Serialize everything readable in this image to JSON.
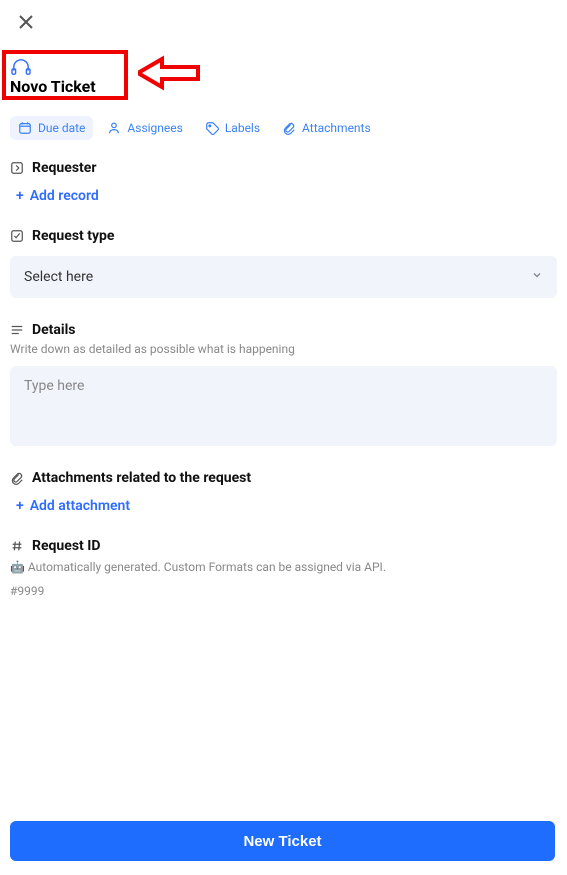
{
  "header": {
    "title": "Novo Ticket"
  },
  "pills": {
    "due_date": "Due date",
    "assignees": "Assignees",
    "labels": "Labels",
    "attachments": "Attachments"
  },
  "requester": {
    "label": "Requester",
    "add": "Add record"
  },
  "request_type": {
    "label": "Request type",
    "placeholder": "Select here"
  },
  "details": {
    "label": "Details",
    "hint": "Write down as detailed as possible what is happening",
    "placeholder": "Type here"
  },
  "attachments_section": {
    "label_prefix": "Attachments related to the ",
    "label_strong": "request",
    "add": "Add attachment"
  },
  "request_id": {
    "label": "Request ID",
    "note_prefix": "🤖 ",
    "note": "Automatically generated. Custom Formats can be assigned via API.",
    "value": "#9999"
  },
  "submit": {
    "label": "New Ticket"
  }
}
